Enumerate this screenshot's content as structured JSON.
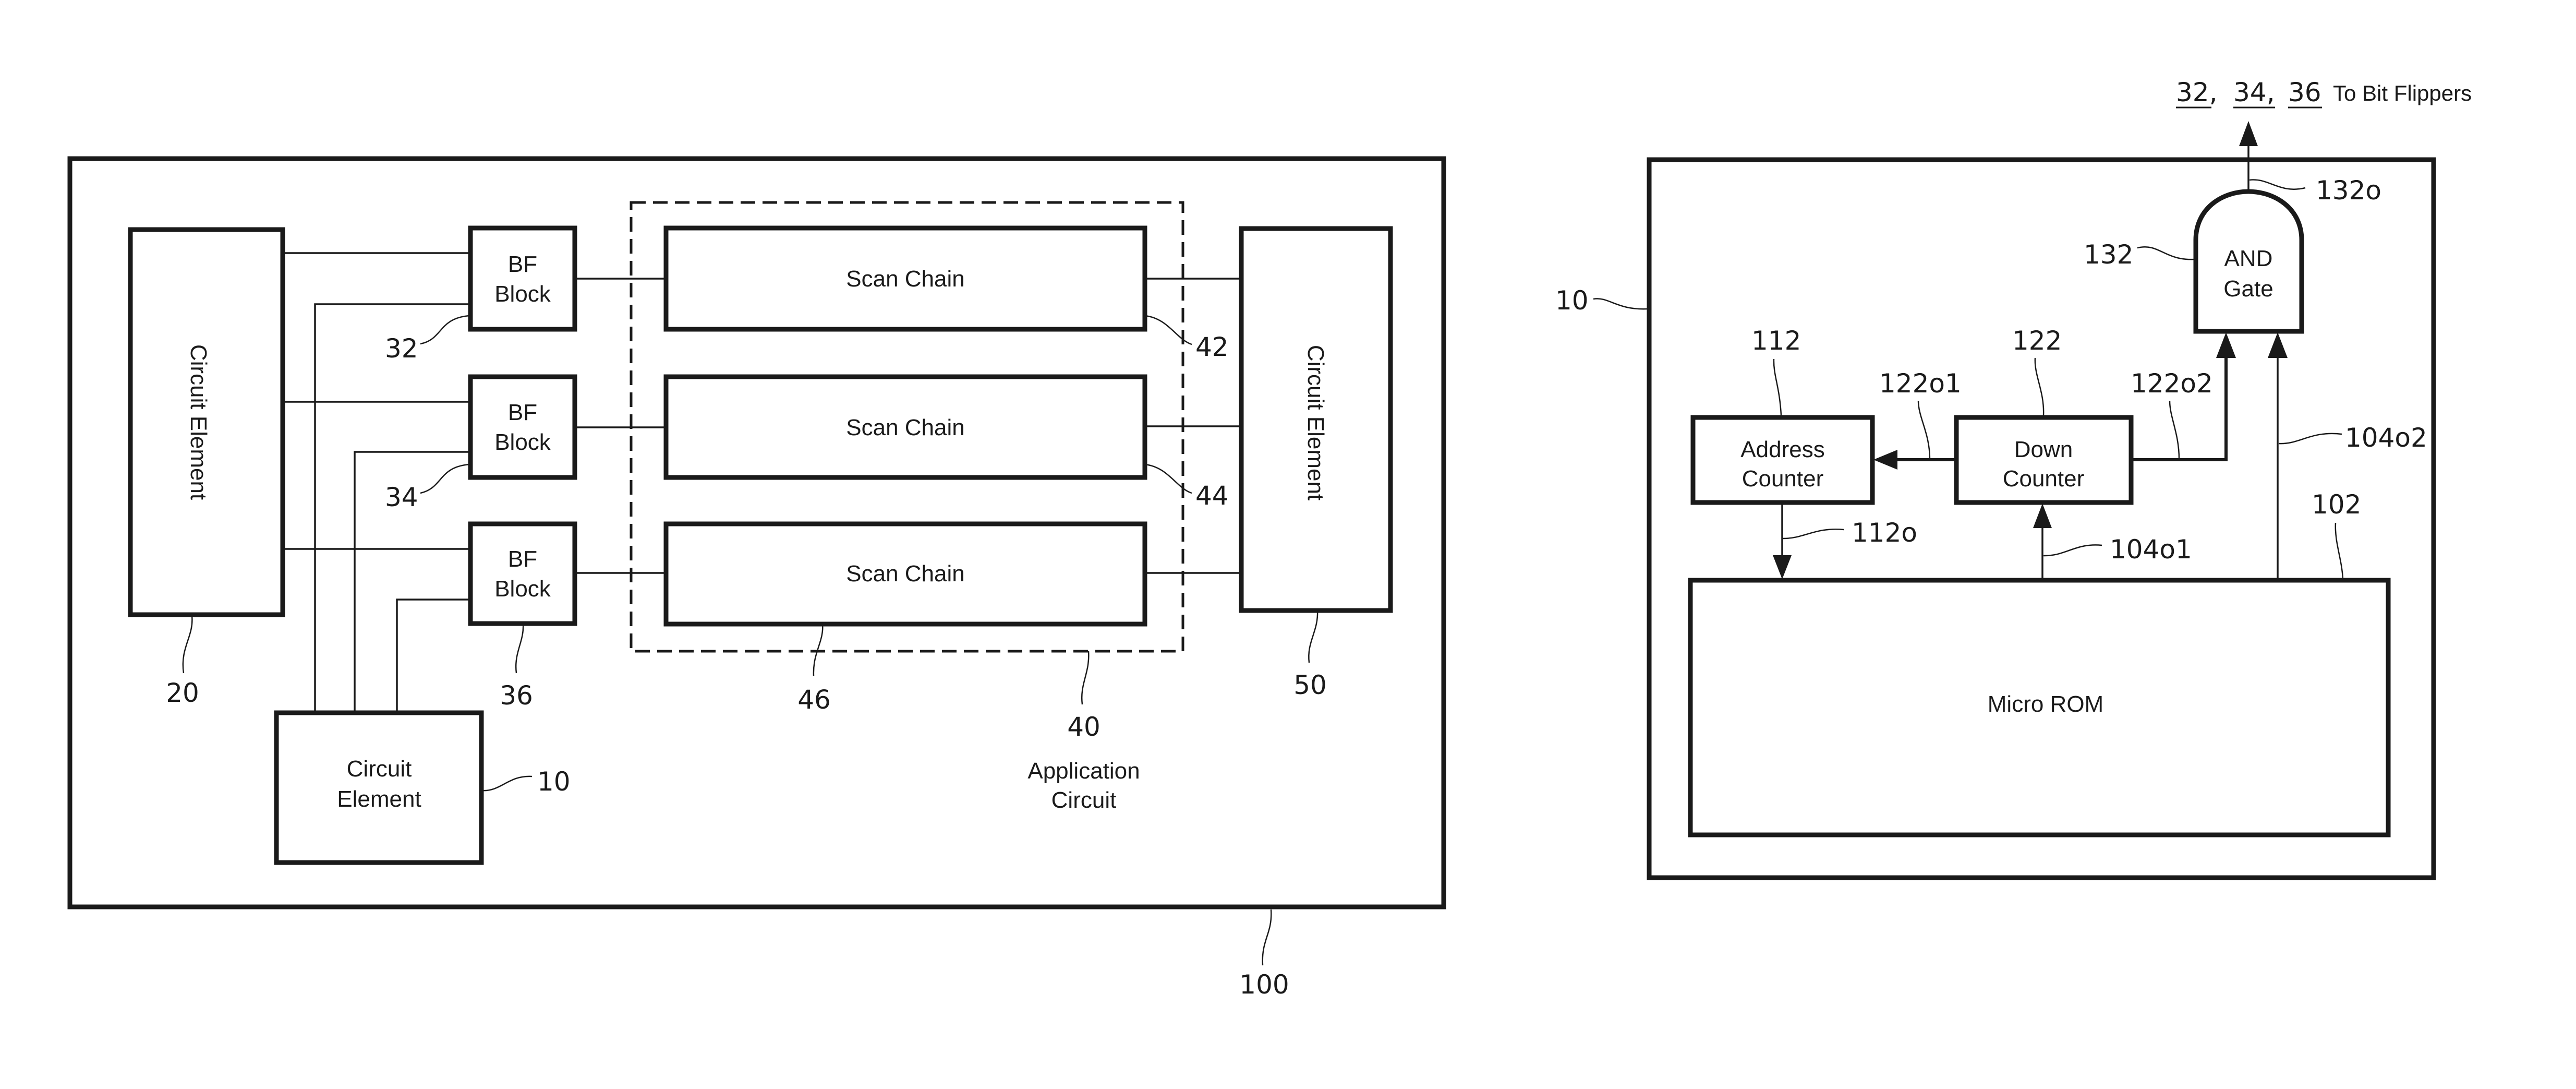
{
  "figure_left": {
    "system_ref": "100",
    "circuit_element_left": {
      "label": "Circuit Element",
      "ref": "20"
    },
    "circuit_element_right": {
      "label": "Circuit Element",
      "ref": "50"
    },
    "circuit_element_bottom": {
      "label_line1": "Circuit",
      "label_line2": "Element",
      "ref": "10"
    },
    "bf_blocks": [
      {
        "line1": "BF",
        "line2": "Block",
        "ref": "32"
      },
      {
        "line1": "BF",
        "line2": "Block",
        "ref": "34"
      },
      {
        "line1": "BF",
        "line2": "Block",
        "ref": "36"
      }
    ],
    "scan_chains": [
      {
        "label": "Scan Chain",
        "ref": "42"
      },
      {
        "label": "Scan Chain",
        "ref": "44"
      },
      {
        "label": "Scan Chain",
        "ref": "46"
      }
    ],
    "application_circuit": {
      "ref": "40",
      "label_line1": "Application",
      "label_line2": "Circuit"
    }
  },
  "figure_right": {
    "circuit_element_ref": "10",
    "output_destination": {
      "refs": [
        "32,",
        "34,",
        "36"
      ],
      "text": "To Bit Flippers"
    },
    "and_gate": {
      "line1": "AND",
      "line2": "Gate",
      "ref": "132",
      "output_ref": "132o"
    },
    "address_counter": {
      "line1": "Address",
      "line2": "Counter",
      "ref": "112",
      "output_ref": "112o"
    },
    "down_counter": {
      "line1": "Down",
      "line2": "Counter",
      "ref": "122",
      "output1_ref": "122o1",
      "output2_ref": "122o2"
    },
    "micro_rom": {
      "label": "Micro ROM",
      "ref": "102",
      "output1_ref": "104o1",
      "output2_ref": "104o2"
    }
  }
}
